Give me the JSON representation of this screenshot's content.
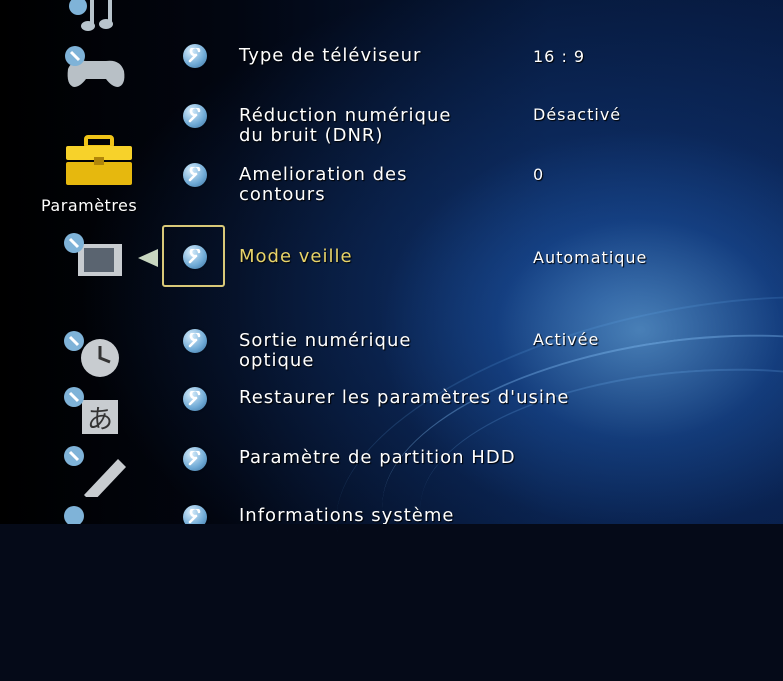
{
  "category": {
    "current_label": "Paramètres",
    "icons": [
      "music-icon",
      "game-icon",
      "settings-toolbox-icon",
      "display-settings-icon",
      "clock-settings-icon",
      "language-settings-icon",
      "remote-settings-icon",
      "other-settings-icon"
    ]
  },
  "settings": [
    {
      "label": "Type de téléviseur",
      "value": "16 : 9"
    },
    {
      "label": "Réduction numérique\ndu bruit (DNR)",
      "value": "Désactivé"
    },
    {
      "label": "Amelioration des\ncontours",
      "value": "0"
    },
    {
      "label": "Mode veille",
      "value": "Automatique",
      "selected": true
    },
    {
      "label": "Sortie numérique\noptique",
      "value": "Activée"
    },
    {
      "label": "Restaurer les paramètres d'usine",
      "value": ""
    },
    {
      "label": "Paramètre de partition HDD",
      "value": ""
    },
    {
      "label": "Informations système",
      "value": ""
    }
  ],
  "colors": {
    "selected": "#e8d46a",
    "normal": "#ffffff",
    "icon": "#7fb3d8",
    "toolbox": "#f0c418"
  }
}
